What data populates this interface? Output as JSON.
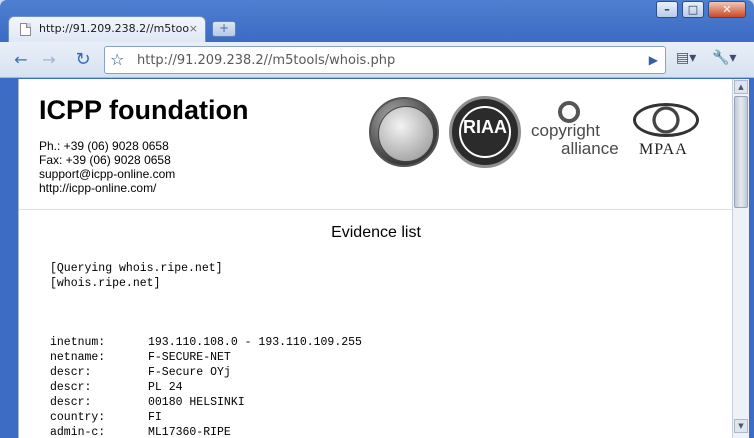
{
  "window": {
    "minimize_glyph": "–",
    "maximize_glyph": "□",
    "close_glyph": "✕"
  },
  "tab": {
    "title": "http://91.209.238.2//m5too...",
    "close_glyph": "×",
    "new_tab_glyph": "+"
  },
  "toolbar": {
    "back_glyph": "←",
    "forward_glyph": "→",
    "reload_glyph": "↻",
    "star_glyph": "☆",
    "url": "http://91.209.238.2//m5tools/whois.php",
    "go_glyph": "▶",
    "page_menu_glyph": "▤▾",
    "wrench_menu_glyph": "🔧▾"
  },
  "header": {
    "org_name": "ICPP foundation",
    "phone": "Ph.: +39 (06) 9028 0658",
    "fax": "Fax: +39 (06) 9028 0658",
    "email": "support@icpp-online.com",
    "website": "http://icpp-online.com/",
    "logos": {
      "riaa": "RIAA",
      "copyright_line1": "copyright",
      "copyright_line2": "alliance",
      "mpaa": "MPAA"
    }
  },
  "evidence": {
    "title": "Evidence list",
    "query_lines": [
      "[Querying whois.ripe.net]",
      "[whois.ripe.net]"
    ],
    "records": [
      {
        "key": "inetnum:",
        "value": "193.110.108.0 - 193.110.109.255"
      },
      {
        "key": "netname:",
        "value": "F-SECURE-NET"
      },
      {
        "key": "descr:",
        "value": "F-Secure OYj"
      },
      {
        "key": "descr:",
        "value": "PL 24"
      },
      {
        "key": "descr:",
        "value": "00180 HELSINKI"
      },
      {
        "key": "country:",
        "value": "FI"
      },
      {
        "key": "admin-c:",
        "value": "ML17360-RIPE"
      }
    ]
  },
  "scrollbar": {
    "up_glyph": "▲",
    "down_glyph": "▼"
  }
}
